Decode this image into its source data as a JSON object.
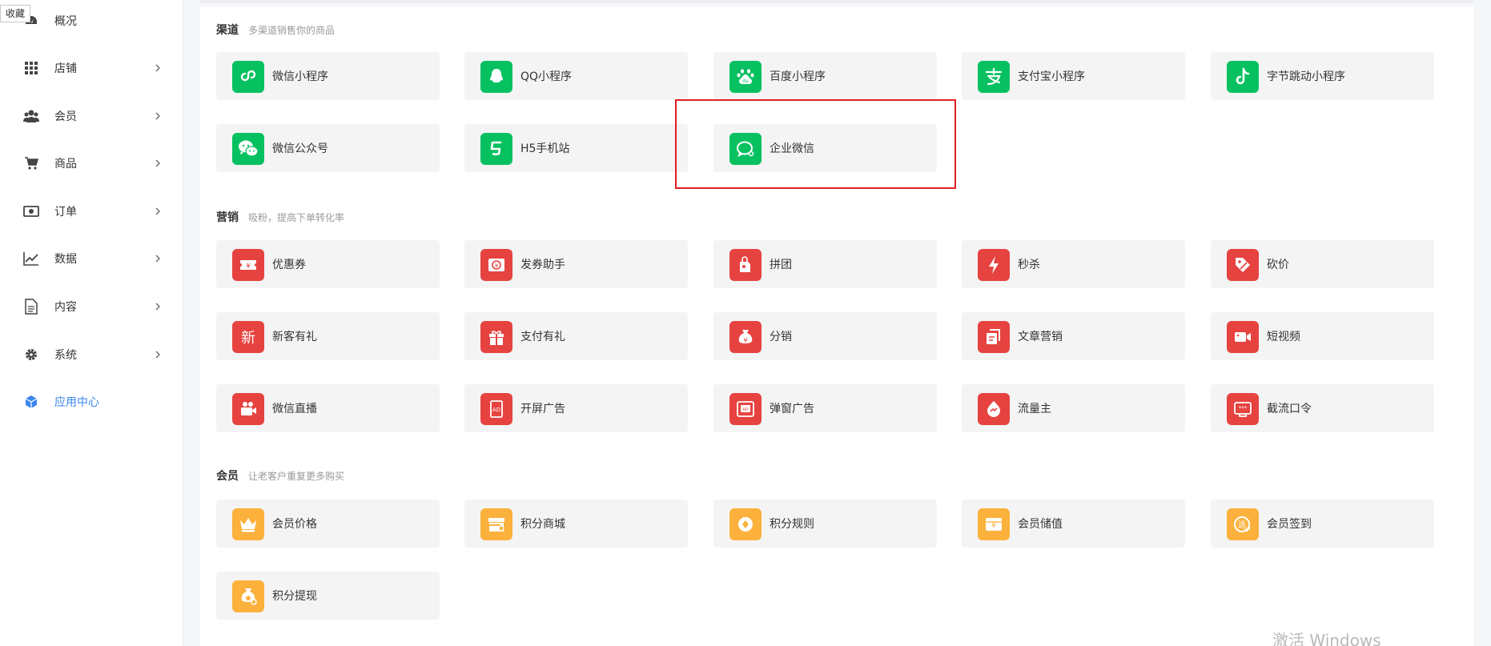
{
  "bookmark_tip": "收藏",
  "sidebar": {
    "items": [
      {
        "label": "概况",
        "icon": "dashboard-icon",
        "has_arrow": false
      },
      {
        "label": "店铺",
        "icon": "grid-icon",
        "has_arrow": true
      },
      {
        "label": "会员",
        "icon": "users-icon",
        "has_arrow": true
      },
      {
        "label": "商品",
        "icon": "cart-icon",
        "has_arrow": true
      },
      {
        "label": "订单",
        "icon": "money-icon",
        "has_arrow": true
      },
      {
        "label": "数据",
        "icon": "chart-icon",
        "has_arrow": true
      },
      {
        "label": "内容",
        "icon": "document-icon",
        "has_arrow": true
      },
      {
        "label": "系统",
        "icon": "gear-icon",
        "has_arrow": true
      },
      {
        "label": "应用中心",
        "icon": "cube-icon",
        "has_arrow": false,
        "active": true
      }
    ]
  },
  "sections": {
    "channel": {
      "name": "渠道",
      "desc": "多渠道销售你的商品",
      "apps": [
        {
          "label": "微信小程序",
          "icon": "wechat-miniprogram-icon",
          "color": "#07c160"
        },
        {
          "label": "QQ小程序",
          "icon": "qq-icon",
          "color": "#07c160"
        },
        {
          "label": "百度小程序",
          "icon": "baidu-icon",
          "color": "#07c160"
        },
        {
          "label": "支付宝小程序",
          "icon": "alipay-icon",
          "color": "#07c160"
        },
        {
          "label": "字节跳动小程序",
          "icon": "tiktok-icon",
          "color": "#07c160"
        },
        {
          "label": "微信公众号",
          "icon": "wechat-icon",
          "color": "#07c160"
        },
        {
          "label": "H5手机站",
          "icon": "html5-icon",
          "color": "#07c160"
        },
        {
          "label": "企业微信",
          "icon": "work-wechat-icon",
          "color": "#07c160"
        }
      ]
    },
    "marketing": {
      "name": "营销",
      "desc": "吸粉，提高下单转化率",
      "apps": [
        {
          "label": "优惠券",
          "icon": "coupon-icon",
          "color": "#e64340"
        },
        {
          "label": "发券助手",
          "icon": "coupon-helper-icon",
          "color": "#e64340"
        },
        {
          "label": "拼团",
          "icon": "group-buy-icon",
          "color": "#e64340"
        },
        {
          "label": "秒杀",
          "icon": "flash-sale-icon",
          "color": "#e64340"
        },
        {
          "label": "砍价",
          "icon": "bargain-icon",
          "color": "#e64340"
        },
        {
          "label": "新客有礼",
          "icon": "new-customer-icon",
          "color": "#e64340"
        },
        {
          "label": "支付有礼",
          "icon": "gift-icon",
          "color": "#e64340"
        },
        {
          "label": "分销",
          "icon": "distribution-icon",
          "color": "#e64340"
        },
        {
          "label": "文章营销",
          "icon": "article-icon",
          "color": "#e64340"
        },
        {
          "label": "短视频",
          "icon": "video-icon",
          "color": "#e64340"
        },
        {
          "label": "微信直播",
          "icon": "live-icon",
          "color": "#e64340"
        },
        {
          "label": "开屏广告",
          "icon": "splash-ad-icon",
          "color": "#e64340"
        },
        {
          "label": "弹窗广告",
          "icon": "popup-ad-icon",
          "color": "#e64340"
        },
        {
          "label": "流量主",
          "icon": "traffic-icon",
          "color": "#e64340"
        },
        {
          "label": "截流口令",
          "icon": "password-icon",
          "color": "#e64340"
        }
      ]
    },
    "member": {
      "name": "会员",
      "desc": "让老客户重复更多购买",
      "apps": [
        {
          "label": "会员价格",
          "icon": "crown-icon",
          "color": "#fbb13c"
        },
        {
          "label": "积分商城",
          "icon": "points-mall-icon",
          "color": "#fbb13c"
        },
        {
          "label": "积分规则",
          "icon": "points-rule-icon",
          "color": "#fbb13c"
        },
        {
          "label": "会员储值",
          "icon": "stored-value-icon",
          "color": "#fbb13c"
        },
        {
          "label": "会员签到",
          "icon": "checkin-icon",
          "color": "#fbb13c"
        },
        {
          "label": "积分提现",
          "icon": "withdraw-icon",
          "color": "#fbb13c"
        }
      ]
    }
  },
  "watermark": "激活 Windows"
}
